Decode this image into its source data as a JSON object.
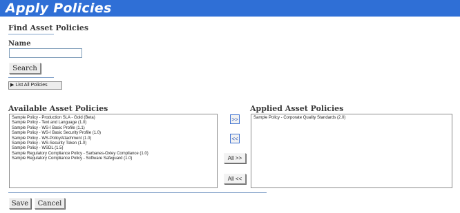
{
  "page": {
    "title": "Apply Policies"
  },
  "find": {
    "heading": "Find Asset Policies",
    "name_label": "Name",
    "name_value": "",
    "search_label": "Search",
    "list_all_label": "▶ List All Policies"
  },
  "available": {
    "heading": "Available Asset Policies",
    "items": [
      "Sample Policy - Production SLA - Gold (Beta)",
      "Sample Policy - Text and Language (1.0)",
      "Sample Policy - WS-I Basic Profile (1.1)",
      "Sample Policy - WS-I Basic Security Profile (1.0)",
      "Sample Policy - WS-PolicyAttachment (1.0)",
      "Sample Policy - WS-Security Token (1.0)",
      "Sample Policy - WSDL (1.5)",
      "Sample Regulatory Compliance Policy - Sarbanes-Oxley Compliance (1.0)",
      "Sample Regulatory Compliance Policy - Software Safeguard (1.0)"
    ]
  },
  "applied": {
    "heading": "Applied Asset Policies",
    "items": [
      "Sample Policy - Corporate Quality Standards (2.0)"
    ]
  },
  "transfer": {
    "add_label": ">>",
    "remove_label": "<<",
    "add_all_label": "All >>",
    "remove_all_label": "All <<"
  },
  "footer": {
    "save_label": "Save",
    "cancel_label": "Cancel"
  },
  "colors": {
    "title_bar": "#2f6fd6",
    "rule": "#7f9fc8"
  }
}
